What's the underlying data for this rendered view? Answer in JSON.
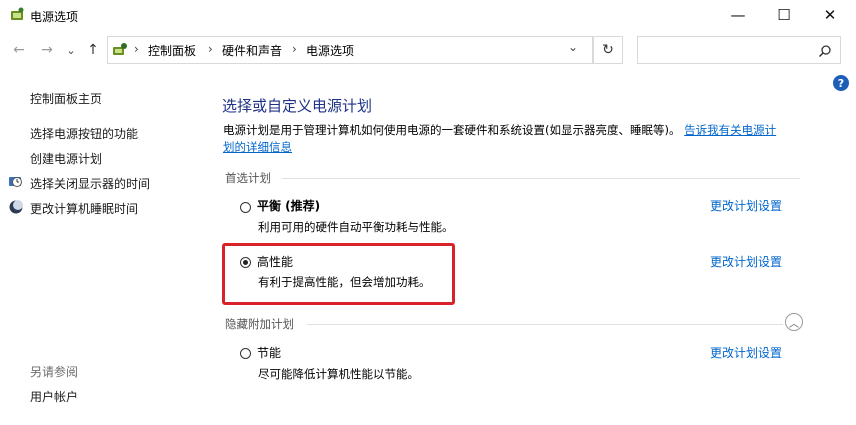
{
  "window": {
    "title": "电源选项",
    "minimize_glyph": "—",
    "maximize_glyph": "☐",
    "close_glyph": "✕"
  },
  "toolbar": {
    "back_glyph": "←",
    "forward_glyph": "→",
    "dropdown_glyph": "⌄",
    "up_glyph": "↑",
    "breadcrumb": [
      "控制面板",
      "硬件和声音",
      "电源选项"
    ],
    "breadcrumb_sep": "›",
    "address_dropdown_glyph": "⌄",
    "refresh_glyph": "↻",
    "search_placeholder": ""
  },
  "help_glyph": "?",
  "sidebar": {
    "home": "控制面板主页",
    "items": [
      {
        "label": "选择电源按钮的功能",
        "icon": "none"
      },
      {
        "label": "创建电源计划",
        "icon": "none"
      },
      {
        "label": "选择关闭显示器的时间",
        "icon": "monitor-clock-icon"
      },
      {
        "label": "更改计算机睡眠时间",
        "icon": "moon-icon"
      }
    ],
    "see_also_title": "另请参阅",
    "see_also_items": [
      "用户帐户"
    ]
  },
  "main": {
    "title": "选择或自定义电源计划",
    "description": "电源计划是用于管理计算机如何使用电源的一套硬件和系统设置(如显示器亮度、睡眠等)。",
    "description_link_1": "告诉我有关电源计",
    "description_link_2": "划的详细信息",
    "preferred_label": "首选计划",
    "hidden_label": "隐藏附加计划",
    "collapse_glyph": "︿",
    "plans": [
      {
        "name": "平衡 (推荐)",
        "desc": "利用可用的硬件自动平衡功耗与性能。",
        "selected": false,
        "change": "更改计划设置"
      },
      {
        "name": "高性能",
        "desc": "有利于提高性能，但会增加功耗。",
        "selected": true,
        "change": "更改计划设置"
      },
      {
        "name": "节能",
        "desc": "尽可能降低计算机性能以节能。",
        "selected": false,
        "change": "更改计划设置"
      }
    ]
  },
  "colors": {
    "accent_title": "#1e3287",
    "link": "#0066cc",
    "highlight_box": "#d8232a"
  }
}
